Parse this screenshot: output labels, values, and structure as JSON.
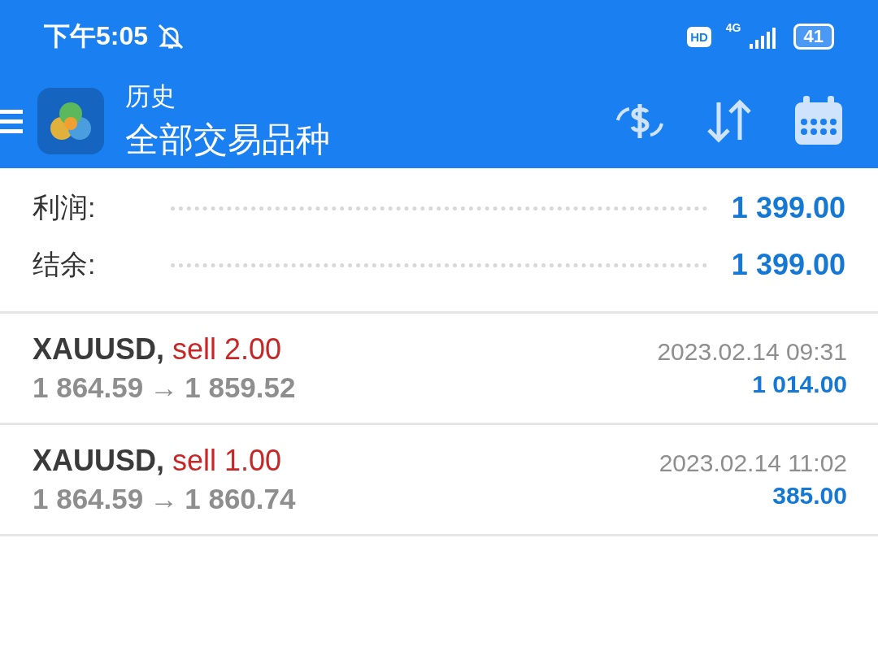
{
  "status_bar": {
    "time": "下午5:05",
    "hd": "HD",
    "network": "4G",
    "battery": "41"
  },
  "header": {
    "title": "历史",
    "subtitle": "全部交易品种"
  },
  "summary": [
    {
      "label": "利润:",
      "value": "1 399.00"
    },
    {
      "label": "结余:",
      "value": "1 399.00"
    }
  ],
  "deals": [
    {
      "symbol": "XAUUSD,",
      "order": "sell 2.00",
      "open_price": "1 864.59",
      "arrow": "→",
      "close_price": "1 859.52",
      "time": "2023.02.14 09:31",
      "profit": "1 014.00"
    },
    {
      "symbol": "XAUUSD,",
      "order": "sell 1.00",
      "open_price": "1 864.59",
      "arrow": "→",
      "close_price": "1 860.74",
      "time": "2023.02.14 11:02",
      "profit": "385.00"
    }
  ]
}
